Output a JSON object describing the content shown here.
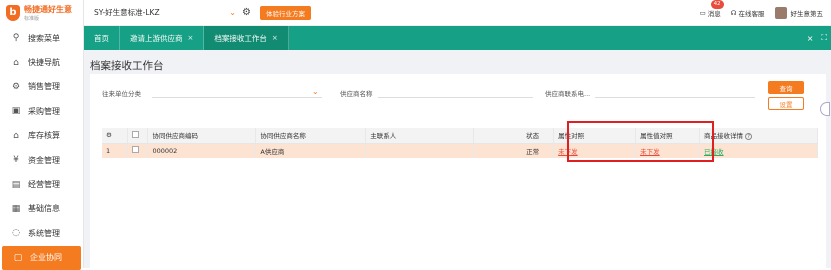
{
  "brand": {
    "name": "畅捷通好生意",
    "edition": "标准版",
    "logo_glyph": "b"
  },
  "sidebar": {
    "items": [
      {
        "label": "搜索菜单",
        "icon": "search-icon",
        "glyph": "⚲"
      },
      {
        "label": "快捷导航",
        "icon": "home-icon",
        "glyph": "⌂"
      },
      {
        "label": "销售管理",
        "icon": "gear-icon",
        "glyph": "⚙"
      },
      {
        "label": "采购管理",
        "icon": "bag-icon",
        "glyph": "▣"
      },
      {
        "label": "库存核算",
        "icon": "warehouse-icon",
        "glyph": "⌂"
      },
      {
        "label": "资金管理",
        "icon": "money-icon",
        "glyph": "¥"
      },
      {
        "label": "经营管理",
        "icon": "report-icon",
        "glyph": "▤"
      },
      {
        "label": "基础信息",
        "icon": "card-icon",
        "glyph": "▦"
      },
      {
        "label": "系统管理",
        "icon": "settings-icon",
        "glyph": "◌"
      },
      {
        "label": "企业协同",
        "icon": "collaboration-icon",
        "glyph": "▢",
        "active": true
      }
    ]
  },
  "topbar": {
    "company": "SY-好生意标准-LKZ",
    "trial_button": "体验行业方案",
    "messages_label": "消息",
    "messages_count": "42",
    "support_label": "在线客服",
    "user_label": "好生意第五"
  },
  "tabs": [
    {
      "label": "首页",
      "closable": false
    },
    {
      "label": "邀请上游供应商",
      "closable": true
    },
    {
      "label": "档案接收工作台",
      "closable": true,
      "active": true
    }
  ],
  "tab_tools": {
    "close": "×",
    "expand": "⛶"
  },
  "page": {
    "title": "档案接收工作台"
  },
  "filters": {
    "unit_category_label": "往来单位分类",
    "supplier_name_label": "供应商名称",
    "supplier_contact_label": "供应商联系电...",
    "query_button": "查询",
    "reset_button": "设置"
  },
  "table": {
    "columns": [
      "",
      "",
      "协同供应商编码",
      "协同供应商名称",
      "主联系人",
      "状态",
      "属性对照",
      "属性值对照",
      "商品接收详情"
    ],
    "rows": [
      {
        "index": "1",
        "code": "000002",
        "name": "A供应商",
        "contact": "",
        "status": "正常",
        "attr_map": "未下发",
        "attr_value_map": "未下发",
        "receive_detail": "已接收"
      }
    ]
  },
  "colors": {
    "accent": "#f47b20",
    "teal": "#16a085",
    "row_highlight": "#fde3d2",
    "annotation_red": "#e02020"
  }
}
